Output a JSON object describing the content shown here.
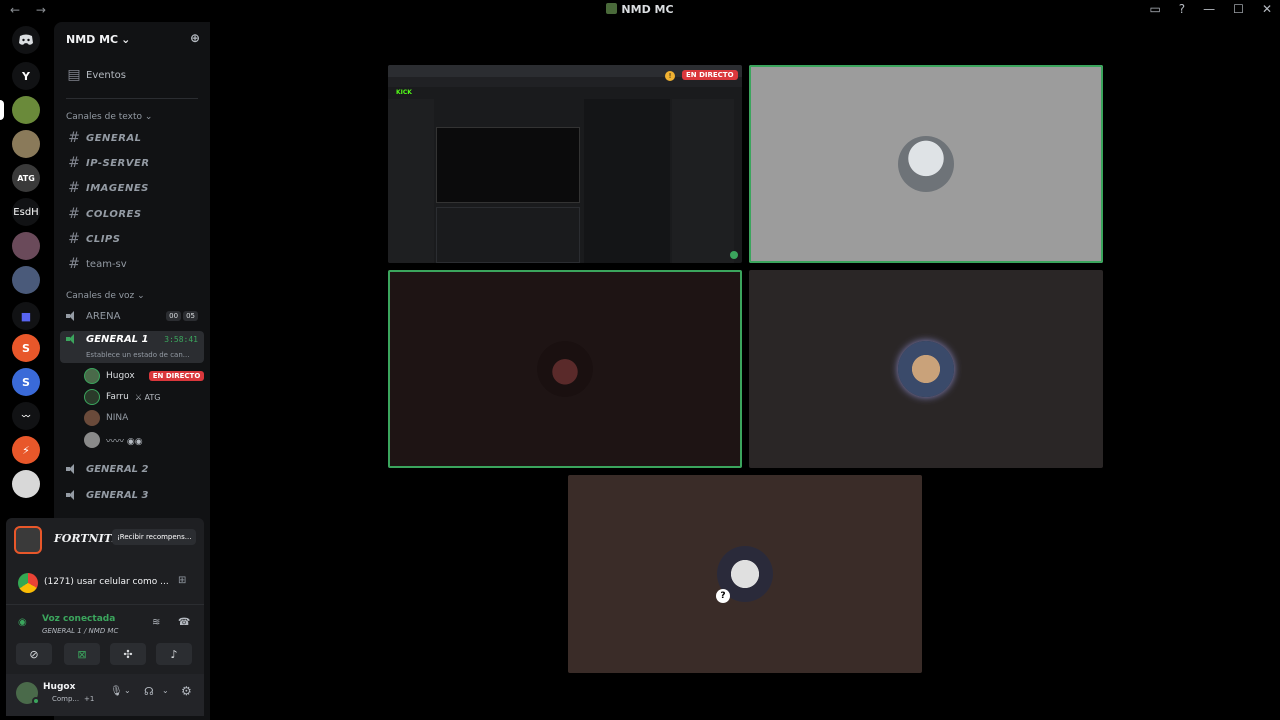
{
  "window": {
    "title": "NMD MC",
    "nav_arrows": "← →",
    "controls": [
      "▭",
      "?",
      "—",
      "☐",
      "✕"
    ]
  },
  "servers": [
    {
      "label": "",
      "icon": "discord-icon",
      "color": "#5865f2"
    },
    {
      "label": "Y",
      "color": "#111214"
    },
    {
      "label": "",
      "color": "#6a8a3a"
    },
    {
      "label": "",
      "color": "#8a7a5a"
    },
    {
      "label": "ATG",
      "color": "#3a3a3a"
    },
    {
      "label": "EsdH",
      "color": "#111214"
    },
    {
      "label": "",
      "color": "#6a4a5a"
    },
    {
      "label": "",
      "color": "#4a5a7a"
    },
    {
      "label": "",
      "color": "#5865f2"
    },
    {
      "label": "S",
      "color": "#e8572a"
    },
    {
      "label": "S",
      "color": "#3a6ad8"
    },
    {
      "label": "",
      "color": "#111214"
    },
    {
      "label": "",
      "color": "#e8572a"
    },
    {
      "label": "",
      "color": "#d8d8d8"
    }
  ],
  "guild": {
    "name": "NMD MC",
    "chevron": "⌄",
    "events_label": "Eventos"
  },
  "text_category": "Canales de texto",
  "text_channels": [
    "GENERAL",
    "IP-SERVER",
    "IMAGENES",
    "COLORES",
    "CLIPS",
    "team-sv"
  ],
  "voice_category": "Canales de voz",
  "voice_channels": {
    "arena": {
      "name": "ARENA",
      "count_a": "00",
      "count_b": "05"
    },
    "general1": {
      "name": "GENERAL 1",
      "timer": "3:58:41",
      "status": "Establece un estado de can..."
    },
    "general2": {
      "name": "GENERAL 2"
    },
    "general3": {
      "name": "GENERAL 3"
    }
  },
  "voice_members": [
    {
      "name": "Hugox",
      "badge": "EN DIRECTO",
      "color": "#4a6a4a"
    },
    {
      "name": "Farru",
      "tag": "ATG",
      "color": "#2a3a2a"
    },
    {
      "name": "NINA",
      "color": "#6a4a3a"
    },
    {
      "name": "",
      "color": "#8a8a8a"
    }
  ],
  "promo": {
    "game": "FORTNITE",
    "action": "¡Recibir recompens..."
  },
  "activity": {
    "text": "(1271) usar celular como ..."
  },
  "voice_status": {
    "title": "Voz conectada",
    "location": "GENERAL 1 / NMD MC"
  },
  "user": {
    "name": "Hugox",
    "status": "Comp...",
    "extra": "+1"
  },
  "stream": {
    "live_label": "EN DIRECTO",
    "site_label": "KICK"
  },
  "colors": {
    "accent_green": "#3ba55d",
    "live_red": "#da373c",
    "blurple": "#5865f2"
  }
}
